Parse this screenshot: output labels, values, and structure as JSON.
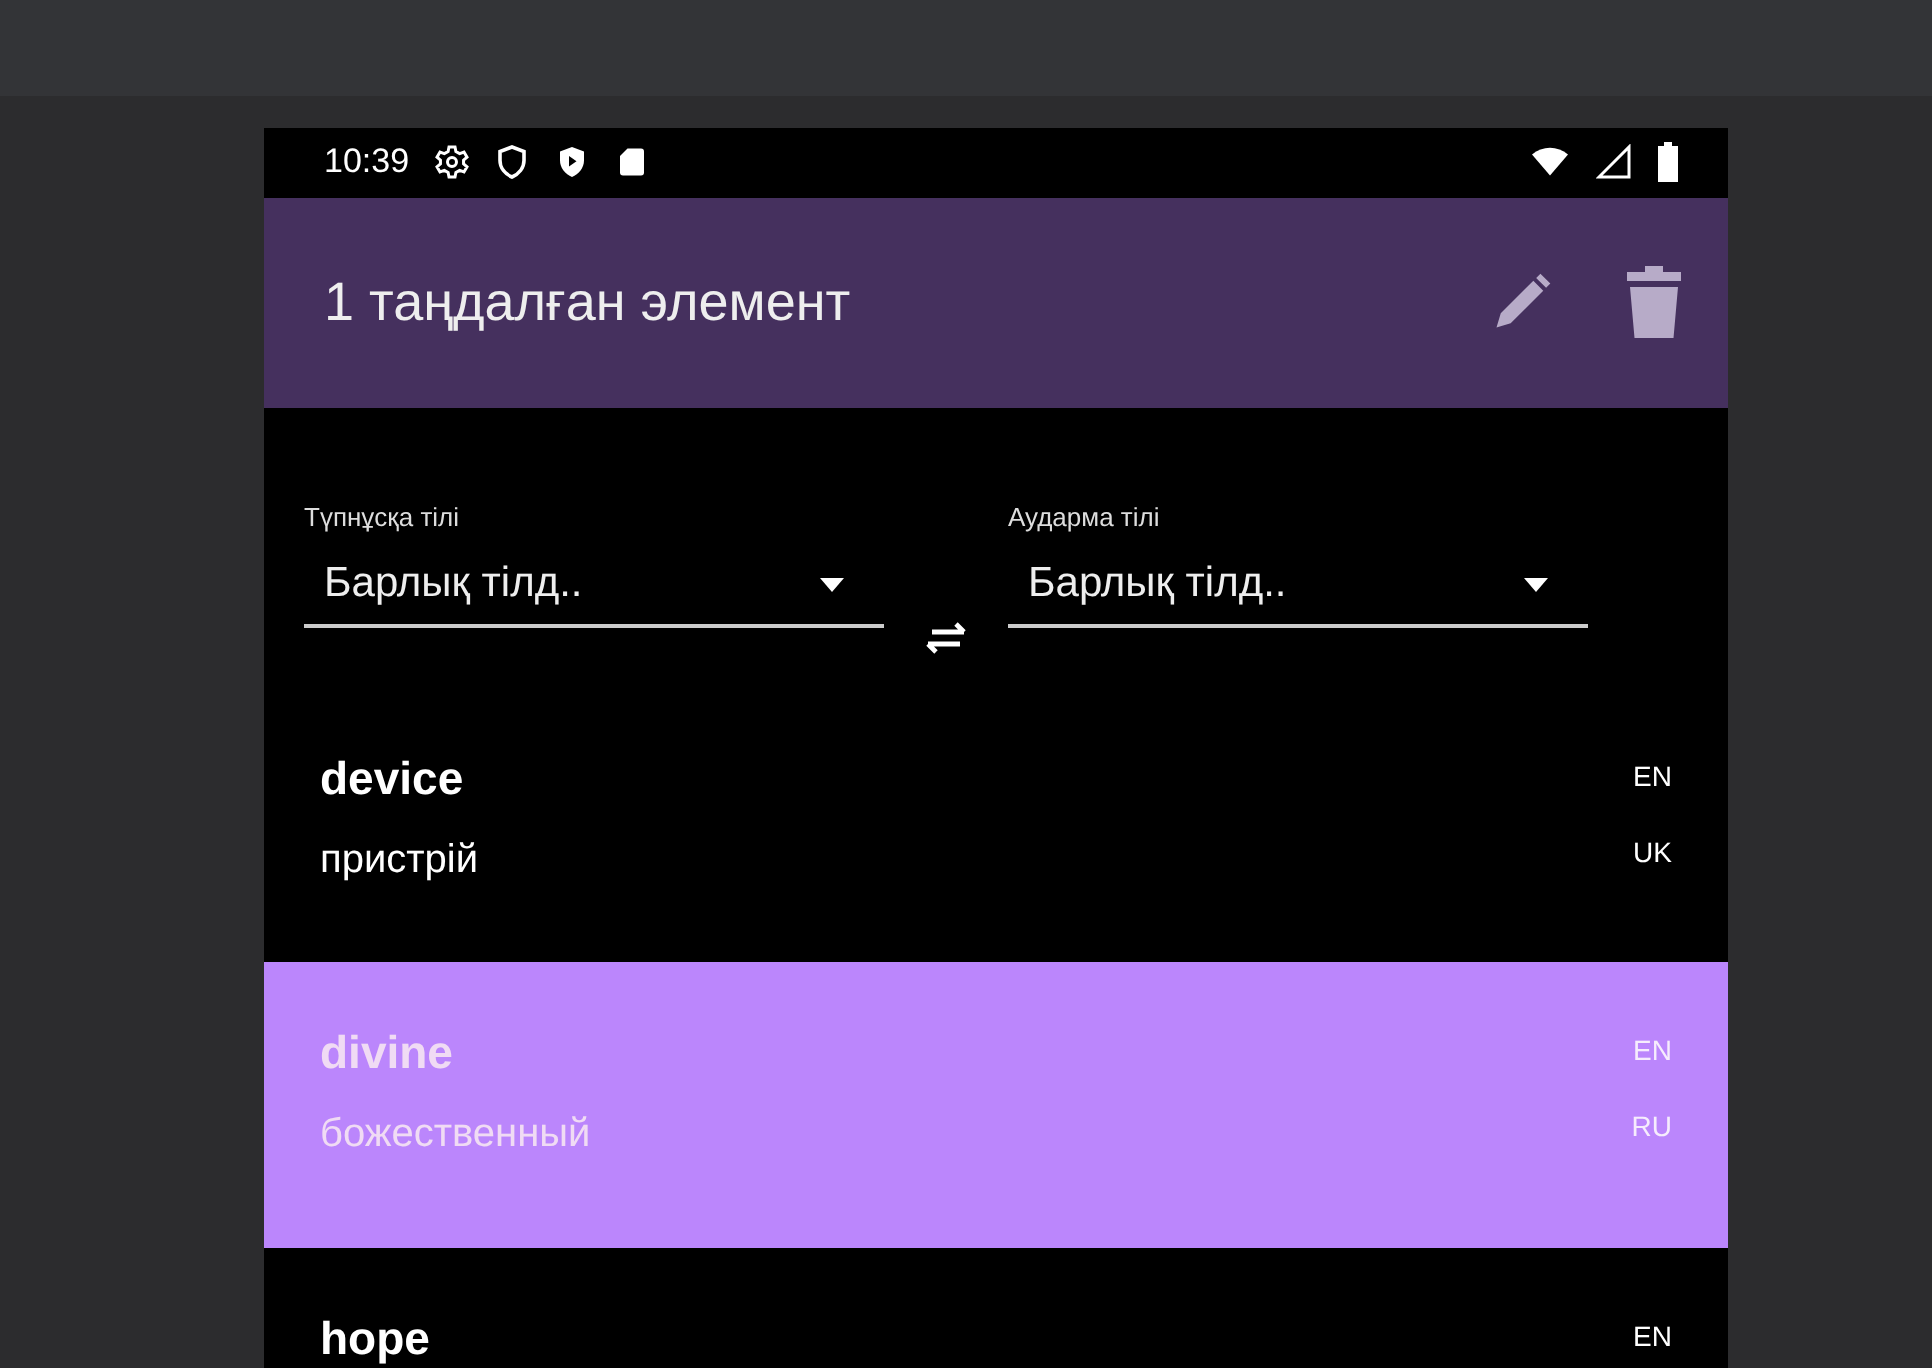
{
  "status_bar": {
    "time": "10:39"
  },
  "app_bar": {
    "title": "1 таңдалған элемент"
  },
  "filters": [
    {
      "label": "Түпнұсқа тілі",
      "value": "Барлық тілд.."
    },
    {
      "label": "Аударма тілі",
      "value": "Барлық тілд.."
    }
  ],
  "words": [
    {
      "term": "device",
      "term_lang": "EN",
      "translation": "пристрій",
      "translation_lang": "UK",
      "selected": false
    },
    {
      "term": "divine",
      "term_lang": "EN",
      "translation": "божественный",
      "translation_lang": "RU",
      "selected": true
    },
    {
      "term": "hope",
      "term_lang": "EN",
      "selected": false
    }
  ]
}
